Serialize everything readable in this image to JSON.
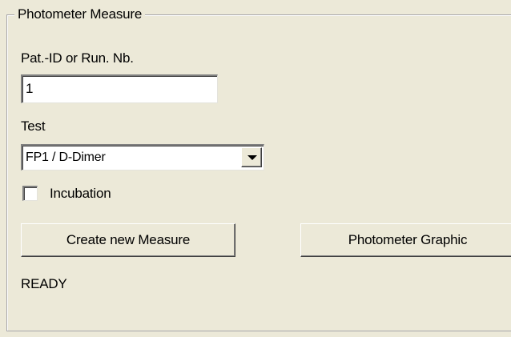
{
  "group": {
    "title": "Photometer Measure"
  },
  "patient": {
    "label": "Pat.-ID or Run. Nb.",
    "value": "1"
  },
  "test": {
    "label": "Test",
    "selected": "FP1 / D-Dimer"
  },
  "incubation": {
    "label": "Incubation",
    "checked": false
  },
  "buttons": {
    "create_label": "Create new Measure",
    "graphic_label": "Photometer Graphic"
  },
  "status": {
    "text": "READY"
  },
  "icons": {
    "dropdown": "chevron-down-icon"
  }
}
